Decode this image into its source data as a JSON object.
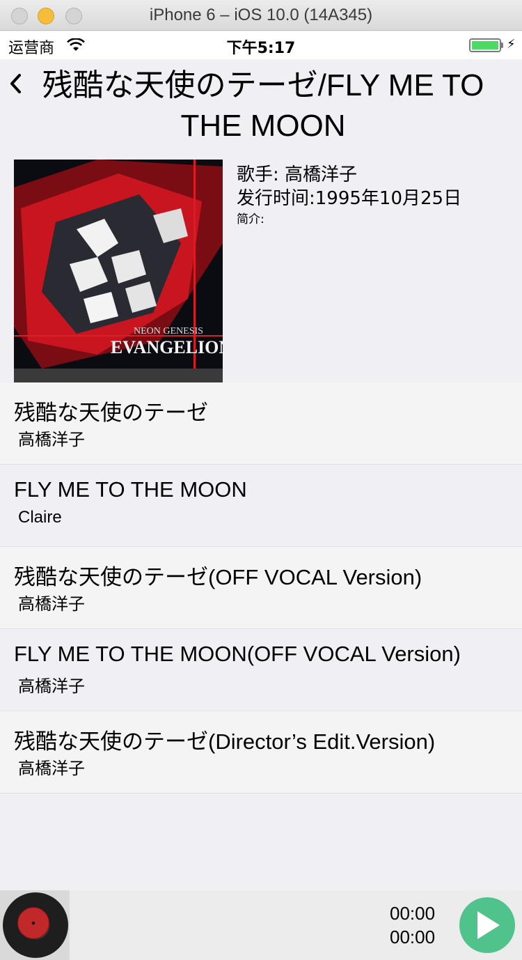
{
  "simulator": {
    "title": "iPhone 6 – iOS 10.0 (14A345)"
  },
  "status_bar": {
    "carrier": "运营商",
    "time": "下午5:17"
  },
  "header": {
    "title": "残酷な天使のテーゼ/FLY ME TO THE MOON"
  },
  "album": {
    "cover_text_1": "NEON GENESIS",
    "cover_text_2": "EVANGELION",
    "singer": "歌手: 高橋洋子",
    "release": "发行时间:1995年10月25日",
    "intro": "简介:"
  },
  "tracks": [
    {
      "title": "残酷な天使のテーゼ",
      "artist": "高橋洋子"
    },
    {
      "title": "FLY ME TO THE MOON",
      "artist": "Claire"
    },
    {
      "title": "残酷な天使のテーゼ(OFF VOCAL Version)",
      "artist": "高橋洋子"
    },
    {
      "title": "FLY ME TO THE MOON(OFF VOCAL Version)",
      "artist": "高橋洋子"
    },
    {
      "title": "残酷な天使のテーゼ(Director’s Edit.Version)",
      "artist": "高橋洋子"
    }
  ],
  "player": {
    "elapsed": "00:00",
    "duration": "00:00"
  },
  "colors": {
    "play_button": "#4fc38b",
    "battery": "#4cd964",
    "disc_label": "#c0282a"
  },
  "icons": {
    "back": "chevron-left-icon",
    "wifi": "wifi-icon",
    "battery": "battery-icon",
    "play": "play-icon",
    "disc": "vinyl-disc-icon"
  }
}
